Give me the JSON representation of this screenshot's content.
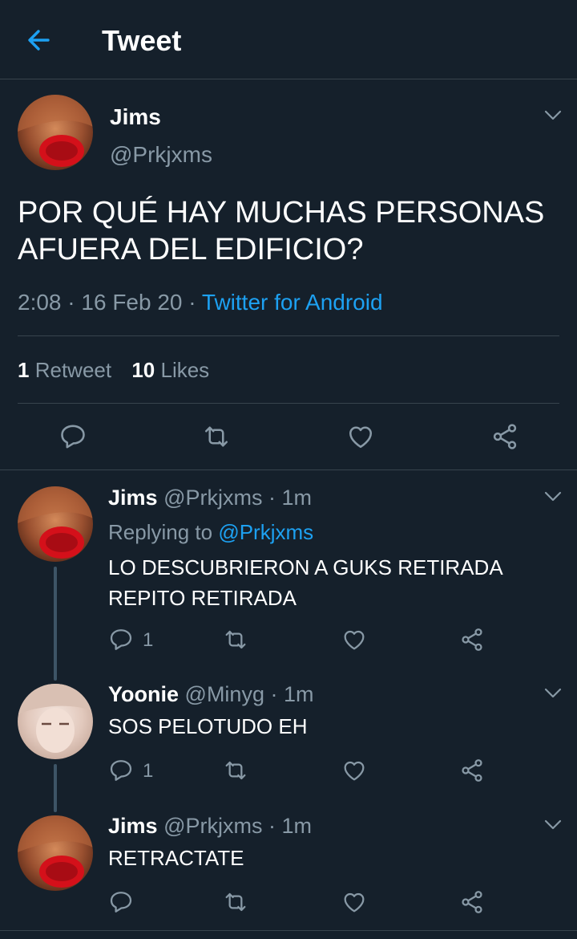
{
  "header": {
    "title": "Tweet"
  },
  "main_tweet": {
    "name": "Jims",
    "handle": "@Prkjxms",
    "text_line1": "POR QUÉ HAY MUCHAS PERSONAS",
    "text_line2": "AFUERA DEL EDIFICIO?",
    "time": "2:08",
    "date": "16 Feb 20",
    "source": "Twitter for Android",
    "retweets_count": "1",
    "retweets_label": "Retweet",
    "likes_count": "10",
    "likes_label": "Likes"
  },
  "replies": [
    {
      "name": "Jims",
      "handle": "@Prkjxms",
      "time": "1m",
      "replying_label": "Replying to",
      "replying_to": "@Prkjxms",
      "text_line1": "LO DESCUBRIERON A GUKS RETIRADA",
      "text_line2": "REPITO RETIRADA",
      "reply_count": "1"
    },
    {
      "name": "Yoonie",
      "handle": "@Minyg",
      "time": "1m",
      "text_line1": "SOS PELOTUDO EH",
      "reply_count": "1"
    },
    {
      "name": "Jims",
      "handle": "@Prkjxms",
      "time": "1m",
      "text_line1": "RETRACTATE"
    }
  ],
  "icons": [
    "back-arrow-icon",
    "chevron-down-icon",
    "reply-icon",
    "retweet-icon",
    "like-icon",
    "share-icon"
  ],
  "colors": {
    "background": "#15202b",
    "accent": "#1da1f2",
    "muted": "#8899a6",
    "divider": "#38444d"
  }
}
